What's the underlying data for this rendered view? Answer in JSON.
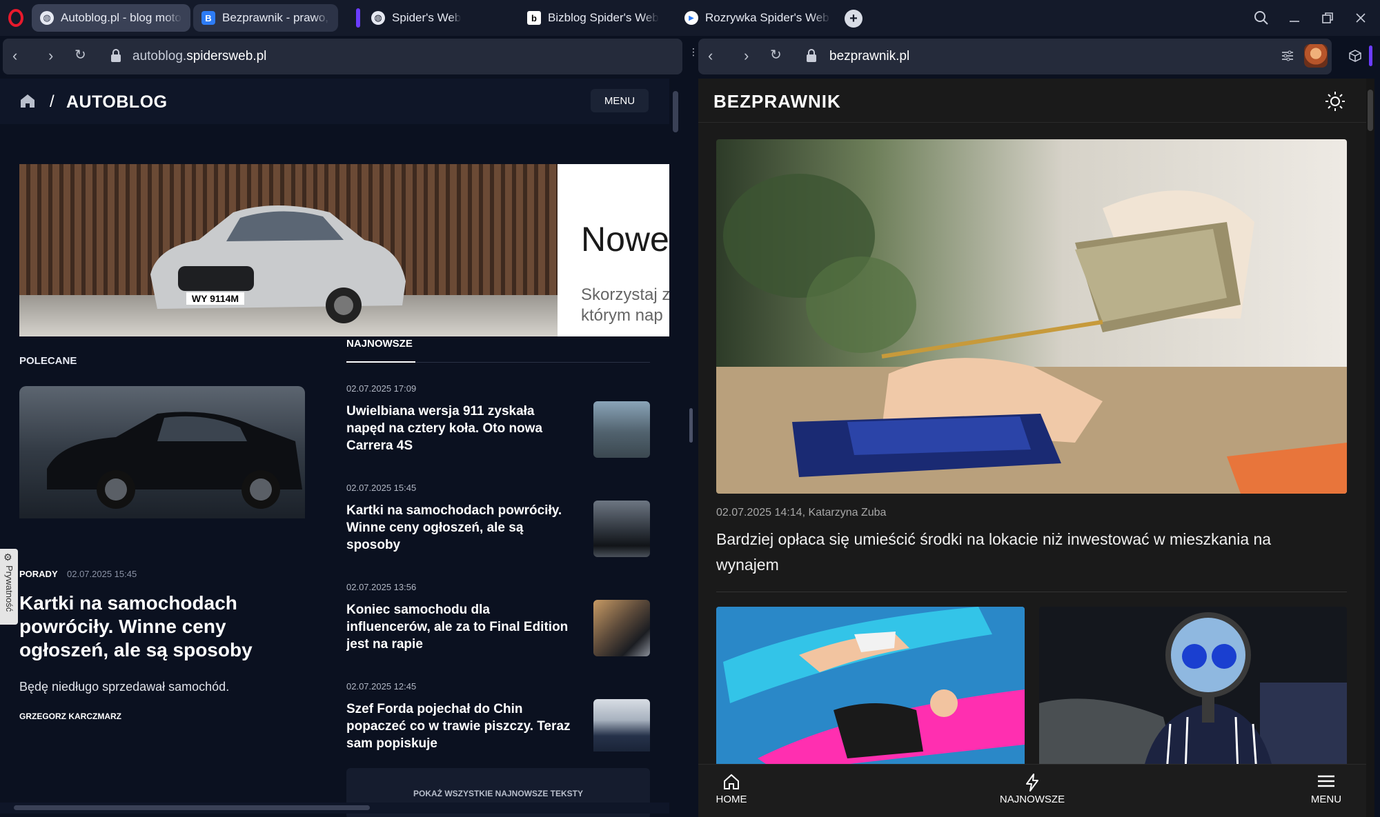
{
  "tabs": [
    {
      "title": "Autoblog.pl - blog motoryzacyjny",
      "favicon": "globe-icon"
    },
    {
      "title": "Bezprawnik - prawo, biznes",
      "favicon": "B"
    },
    {
      "title": "Spider's Web",
      "favicon": "globe-icon"
    },
    {
      "title": "Bizblog Spider's Web",
      "favicon": "b"
    },
    {
      "title": "Rozrywka Spider's Web - Ciekawostki",
      "favicon": "play-icon"
    }
  ],
  "left": {
    "url_prefix": "autoblog.",
    "url_domain": "spidersweb.pl",
    "brand": "AUTOBLOG",
    "slash": "/",
    "menu_label": "MENU",
    "ad": {
      "headline": "Nowe",
      "body_line1": "Skorzystaj z",
      "body_line2": "którym nap",
      "plate": "WY 9114M"
    },
    "recommended_label": "POLECANE",
    "featured": {
      "category": "PORADY",
      "date": "02.07.2025 15:45",
      "title": "Kartki na samochodach powróciły. Winne ceny ogłoszeń, ale są sposoby",
      "lead": "Będę niedługo sprzedawał samochód.",
      "author": "GRZEGORZ KARCZMARZ"
    },
    "latest_label": "NAJNOWSZE",
    "latest": [
      {
        "date": "02.07.2025 17:09",
        "title": "Uwielbiana wersja 911 zyskała napęd na cztery koła. Oto nowa Carrera 4S"
      },
      {
        "date": "02.07.2025 15:45",
        "title": "Kartki na samochodach powróciły. Winne ceny ogłoszeń, ale są sposoby"
      },
      {
        "date": "02.07.2025 13:56",
        "title": "Koniec samochodu dla influencerów, ale za to Final Edition jest na rapie"
      },
      {
        "date": "02.07.2025 12:45",
        "title": "Szef Forda pojechał do Chin popaczeć co w trawie piszczy. Teraz sam popiskuje"
      }
    ],
    "show_all_label": "POKAŻ WSZYSTKIE NAJNOWSZE TEKSTY",
    "privacy_label": "Prywatność"
  },
  "right": {
    "url": "bezprawnik.pl",
    "brand": "BEZPRAWNIK",
    "article": {
      "meta": "02.07.2025 14:14, Katarzyna Zuba",
      "title": "Bardziej opłaca się umieścić środki na lokacie niż inwestować w mieszkania na wynajem"
    },
    "bottom_nav": [
      {
        "label": "HOME",
        "icon": "home-icon"
      },
      {
        "label": "NAJNOWSZE",
        "icon": "lightning-icon"
      },
      {
        "label": "MENU",
        "icon": "hamburger-icon"
      }
    ]
  },
  "colors": {
    "accent": "#6b3cff",
    "opera_red": "#e8192c",
    "left_bg": "#0b1120",
    "right_bg": "#1a1a1a"
  }
}
